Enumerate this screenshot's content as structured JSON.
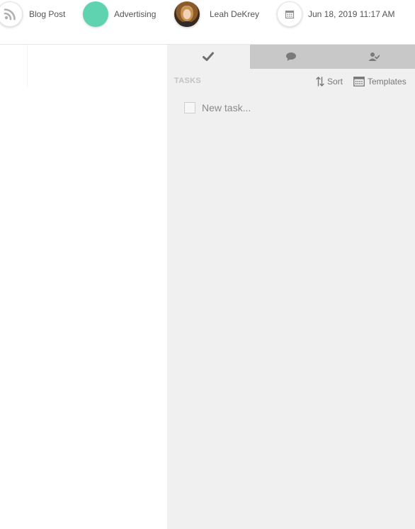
{
  "meta_bar": {
    "post_type": {
      "label": "Blog Post",
      "icon": "rss-icon"
    },
    "category": {
      "label": "Advertising",
      "color": "#5fd3b0"
    },
    "author": {
      "name": "Leah DeKrey",
      "icon": "avatar"
    },
    "date": {
      "value": "Jun 18, 2019 11:17 AM",
      "icon": "calendar-icon"
    }
  },
  "sidebar": {
    "tabs": [
      {
        "name": "tasks",
        "icon": "checkmark-icon",
        "active": true
      },
      {
        "name": "comments",
        "icon": "comment-icon",
        "active": false
      },
      {
        "name": "approvals",
        "icon": "user-approval-icon",
        "active": false
      }
    ],
    "tasks": {
      "title": "TASKS",
      "sort_label": "Sort",
      "templates_label": "Templates",
      "new_task_placeholder": "New task..."
    }
  },
  "colors": {
    "sidebar_bg": "#f0f0f0",
    "inactive_tab_bg": "#c8c8c8",
    "category_color": "#5fd3b0"
  }
}
